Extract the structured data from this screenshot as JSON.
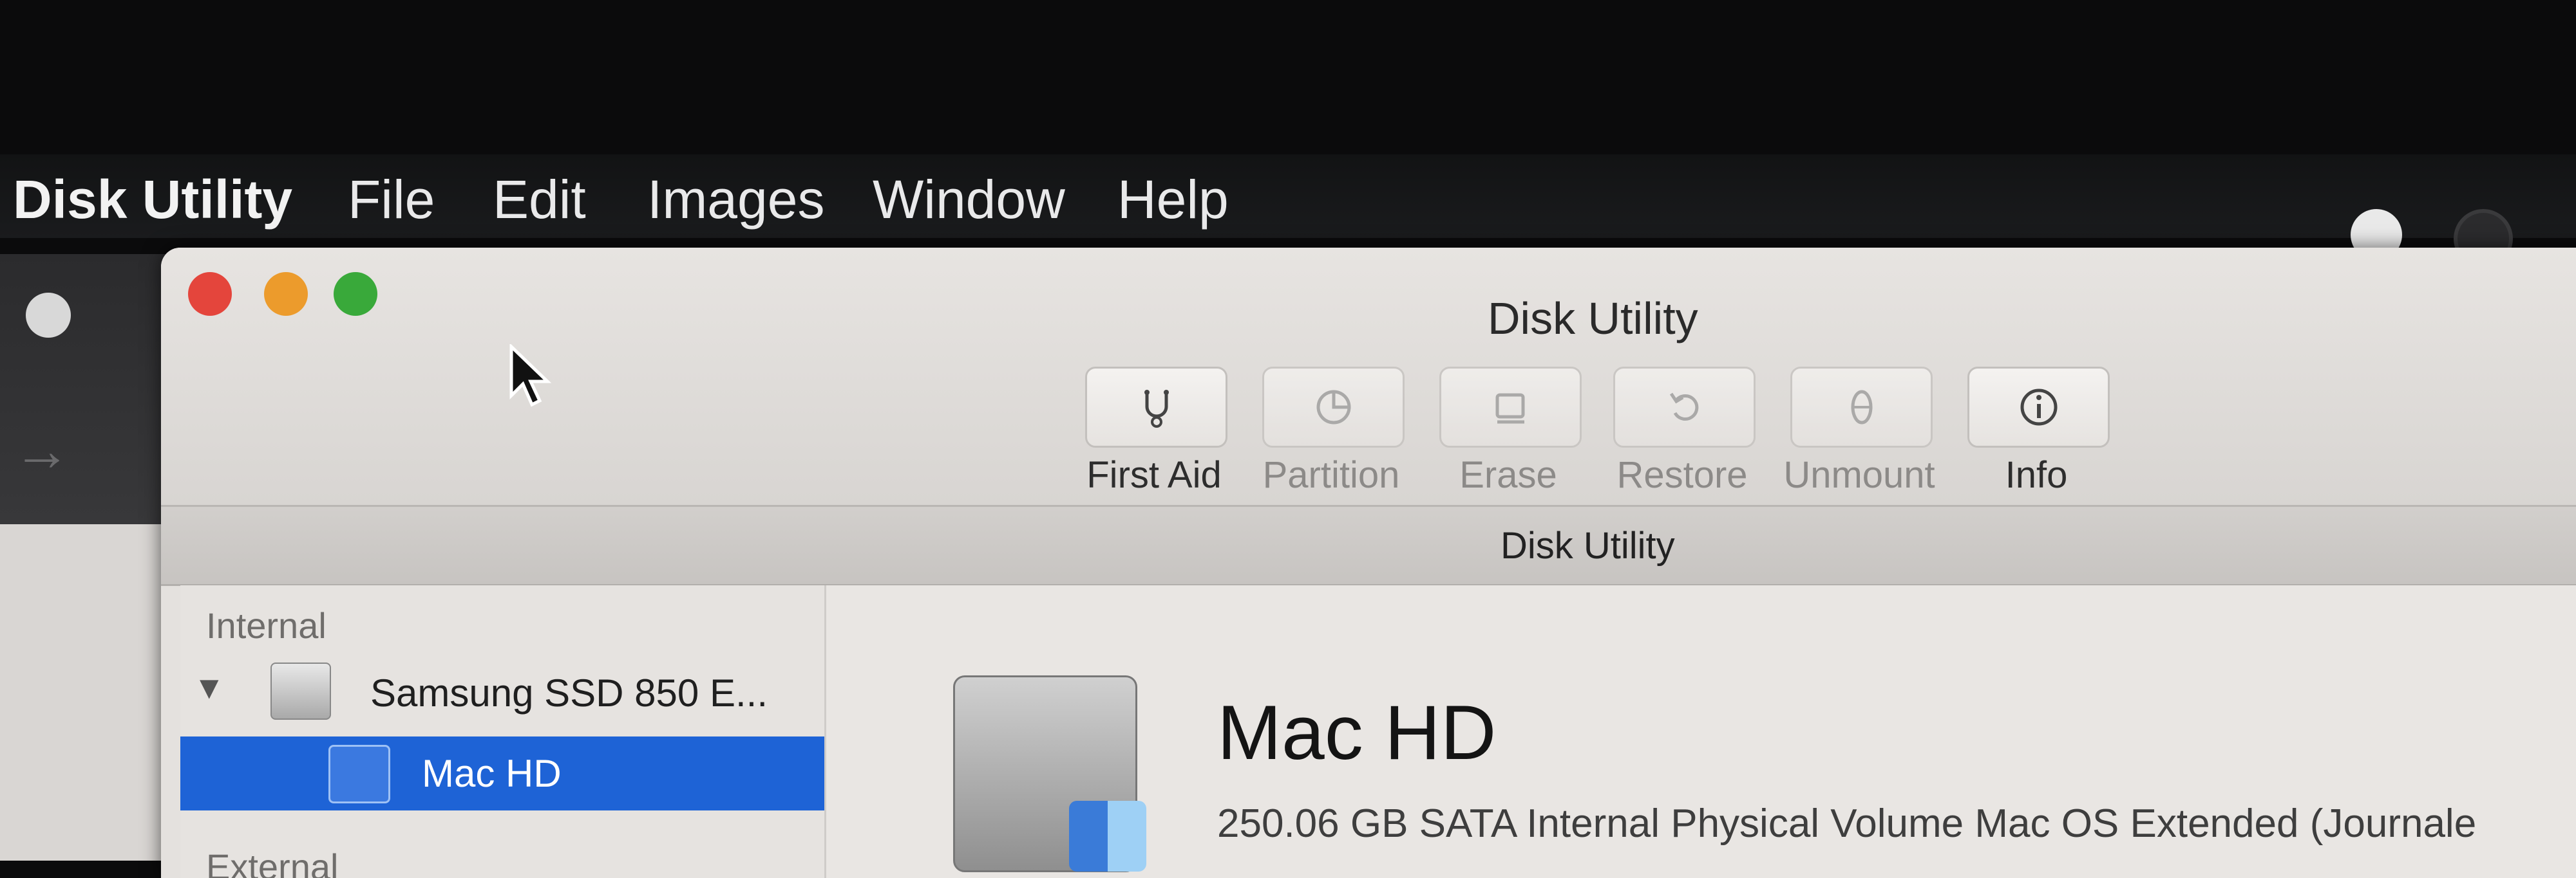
{
  "menubar": {
    "app_name": "Disk Utility",
    "items": [
      "File",
      "Edit",
      "Images",
      "Window",
      "Help"
    ]
  },
  "window": {
    "title": "Disk Utility",
    "section_title": "Disk Utility",
    "toolbar": [
      {
        "label": "First Aid",
        "icon": "stethoscope-icon",
        "enabled": true
      },
      {
        "label": "Partition",
        "icon": "pie-chart-icon",
        "enabled": false
      },
      {
        "label": "Erase",
        "icon": "eraser-icon",
        "enabled": false
      },
      {
        "label": "Restore",
        "icon": "restore-icon",
        "enabled": false
      },
      {
        "label": "Unmount",
        "icon": "eject-icon",
        "enabled": false
      },
      {
        "label": "Info",
        "icon": "info-icon",
        "enabled": true
      }
    ]
  },
  "sidebar": {
    "internal_heading": "Internal",
    "disk_name": "Samsung SSD 850 E...",
    "volume_name": "Mac HD",
    "external_heading": "External"
  },
  "detail": {
    "volume_title": "Mac HD",
    "description": "250.06 GB SATA Internal Physical Volume Mac OS Extended (Journale"
  },
  "colors": {
    "selection": "#1e63d6",
    "close": "#e4453c",
    "minimize": "#ec9b2c",
    "zoom": "#39a93a"
  }
}
